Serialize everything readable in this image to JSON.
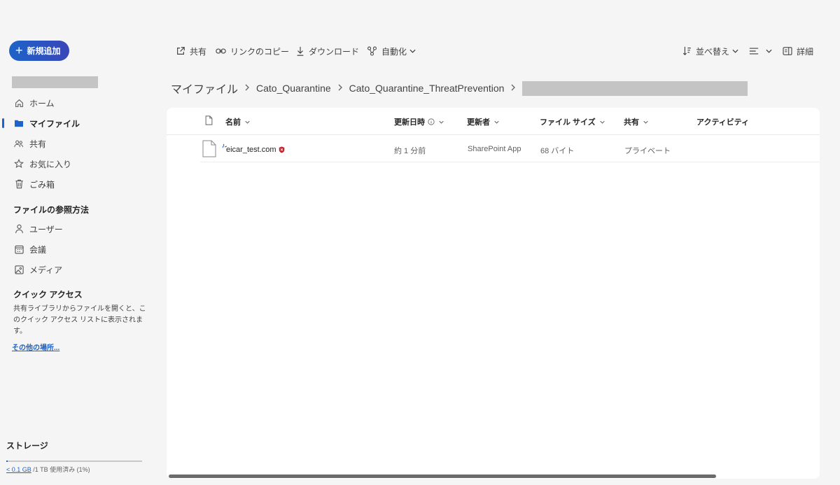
{
  "sidebar": {
    "new_button": "新規追加",
    "nav": [
      {
        "label": "ホーム",
        "icon": "home-icon"
      },
      {
        "label": "マイファイル",
        "icon": "folder-icon"
      },
      {
        "label": "共有",
        "icon": "people-icon"
      },
      {
        "label": "お気に入り",
        "icon": "star-icon"
      },
      {
        "label": "ごみ箱",
        "icon": "trash-icon"
      }
    ],
    "browse_title": "ファイルの参照方法",
    "browse": [
      {
        "label": "ユーザー",
        "icon": "person-icon"
      },
      {
        "label": "会議",
        "icon": "calendar-icon"
      },
      {
        "label": "メディア",
        "icon": "image-icon"
      }
    ],
    "quick_title": "クイック アクセス",
    "quick_desc": "共有ライブラリからファイルを開くと、このクイック アクセス リストに表示されます。",
    "more_link": "その他の場所...",
    "storage_title": "ストレージ",
    "storage_used": "< 0.1 GB",
    "storage_rest": " /1 TB 使用済み (1%)",
    "storage_fraction": 0.01
  },
  "toolbar": {
    "share": "共有",
    "copy_link": "リンクのコピー",
    "download": "ダウンロード",
    "automate": "自動化",
    "sort": "並べ替え",
    "details": "詳細"
  },
  "breadcrumb": {
    "root": "マイファイル",
    "level1": "Cato_Quarantine",
    "level2": "Cato_Quarantine_ThreatPrevention"
  },
  "table": {
    "headers": {
      "name": "名前",
      "modified": "更新日時",
      "modified_by": "更新者",
      "size": "ファイル サイズ",
      "sharing": "共有",
      "activity": "アクティビティ"
    },
    "rows": [
      {
        "name": "eicar_test.com",
        "modified": "約 1 分前",
        "modified_by": "SharePoint App",
        "size": "68 バイト",
        "sharing": "プライベート"
      }
    ]
  }
}
